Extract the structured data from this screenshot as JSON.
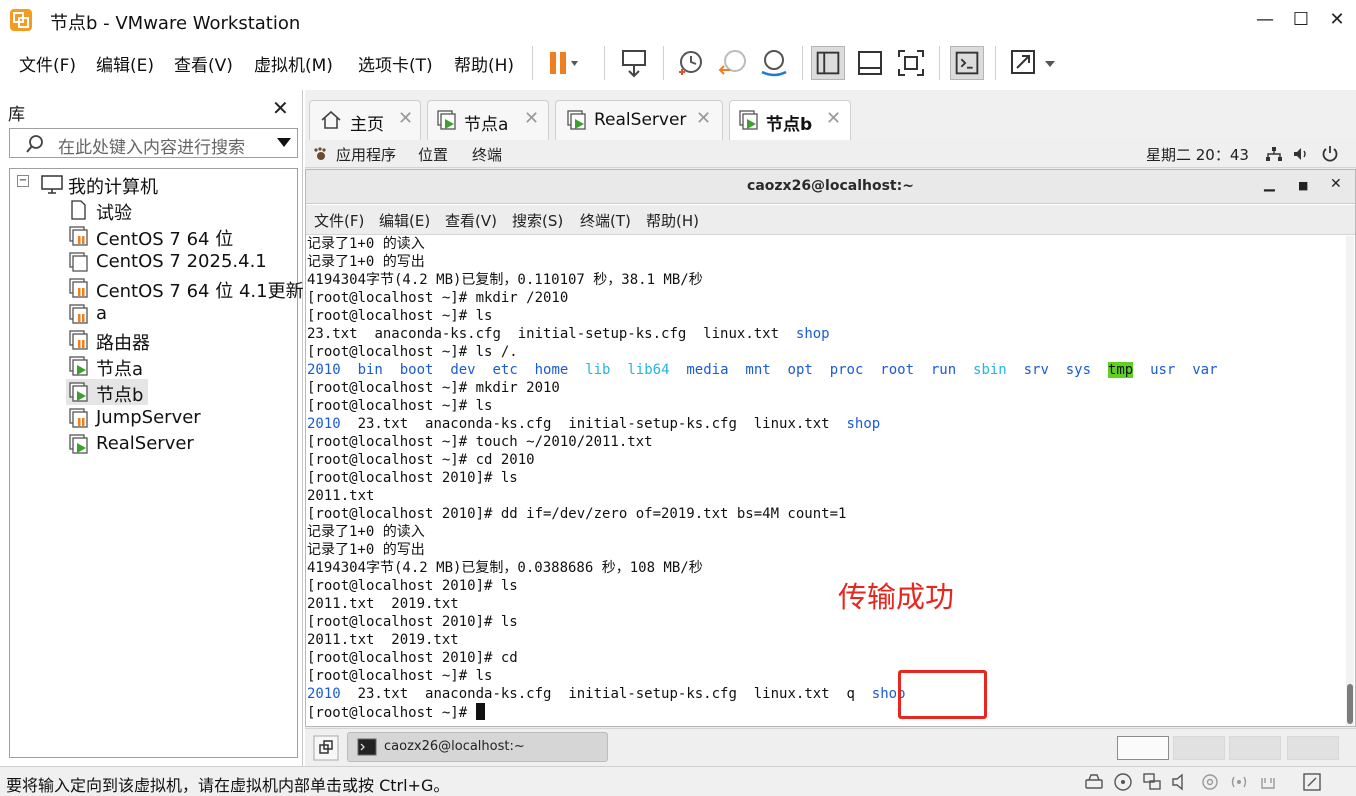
{
  "window": {
    "title": "节点b - VMware Workstation"
  },
  "menu": [
    "文件(F)",
    "编辑(E)",
    "查看(V)",
    "虚拟机(M)",
    "选项卡(T)",
    "帮助(H)"
  ],
  "library": {
    "header": "库",
    "search_placeholder": "在此处键入内容进行搜索",
    "root": "我的计算机",
    "items": [
      "试验",
      "CentOS 7 64 位",
      "CentOS 7 2025.4.1",
      "CentOS 7 64 位 4.1更新",
      "a",
      "路由器",
      "节点a",
      "节点b",
      "JumpServer",
      "RealServer"
    ]
  },
  "tabs": [
    "主页",
    "节点a",
    "RealServer",
    "节点b"
  ],
  "guest": {
    "topbar": {
      "apps": "应用程序",
      "places": "位置",
      "terminal": "终端",
      "clock": "星期二 20：43"
    },
    "terminal": {
      "title": "caozx26@localhost:~",
      "menu": [
        "文件(F)",
        "编辑(E)",
        "查看(V)",
        "搜索(S)",
        "终端(T)",
        "帮助(H)"
      ],
      "lines": [
        "记录了1+0 的读入",
        "记录了1+0 的写出",
        "4194304字节(4.2 MB)已复制，0.110107 秒，38.1 MB/秒",
        "[root@localhost ~]# mkdir /2010",
        "[root@localhost ~]# ls",
        "23.txt  anaconda-ks.cfg  initial-setup-ks.cfg  linux.txt  shop",
        "[root@localhost ~]# ls /.",
        "2010  bin  boot  dev  etc  home  lib  lib64  media  mnt  opt  proc  root  run  sbin  srv  sys  tmp  usr  var",
        "[root@localhost ~]# mkdir 2010",
        "[root@localhost ~]# ls",
        "2010  23.txt  anaconda-ks.cfg  initial-setup-ks.cfg  linux.txt  shop",
        "[root@localhost ~]# touch ~/2010/2011.txt",
        "[root@localhost ~]# cd 2010",
        "[root@localhost 2010]# ls",
        "2011.txt",
        "[root@localhost 2010]# dd if=/dev/zero of=2019.txt bs=4M count=1",
        "记录了1+0 的读入",
        "记录了1+0 的写出",
        "4194304字节(4.2 MB)已复制，0.0388686 秒，108 MB/秒",
        "[root@localhost 2010]# ls",
        "2011.txt  2019.txt",
        "[root@localhost 2010]# ls",
        "2011.txt  2019.txt",
        "[root@localhost 2010]# cd",
        "[root@localhost ~]# ls",
        "2010  23.txt  anaconda-ks.cfg  initial-setup-ks.cfg  linux.txt  q  shop",
        "[root@localhost ~]# "
      ]
    },
    "taskbar_item": "caozx26@localhost:~"
  },
  "annotation": "传输成功",
  "statusbar": "要将输入定向到该虚拟机，请在虚拟机内部单击或按 Ctrl+G。",
  "colors": {
    "dir_blue": "#1a5bd6",
    "link_cyan": "#22b6d9",
    "tmp_bg": "#5fd120",
    "annotation_red": "#e8261d",
    "pause_orange": "#f07d1e"
  }
}
